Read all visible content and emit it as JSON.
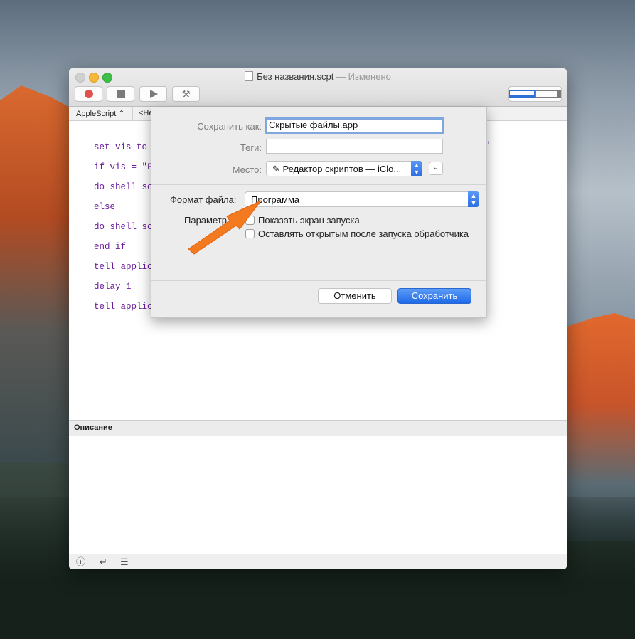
{
  "window": {
    "title": "Без названия.scpt",
    "title_status": "— Изменено"
  },
  "toolbar": {
    "record_label": "Record",
    "stop_label": "Stop",
    "run_label": "Run",
    "compile_label": "Compile"
  },
  "navbar": {
    "language": "AppleScript",
    "element": "<He"
  },
  "editor": {
    "lines": [
      "set vis to",
      "if vis = \"F",
      "do shell sc",
      "else",
      "do shell sc",
      "end if",
      "tell applic",
      "delay 1",
      "tell applic"
    ],
    "line1_tail": "\""
  },
  "description_panel": {
    "header": "Описание"
  },
  "save_sheet": {
    "save_as_label": "Сохранить как:",
    "save_as_value": "Скрытые файлы.app",
    "tags_label": "Теги:",
    "tags_value": "",
    "location_label": "Место:",
    "location_value": "Редактор скриптов — iClo...",
    "file_format_label": "Формат файла:",
    "file_format_value": "Программа",
    "options_label": "Параметр",
    "option1": "Показать экран запуска",
    "option2": "Оставлять открытым после запуска обработчика",
    "cancel_label": "Отменить",
    "save_label": "Сохранить"
  },
  "colors": {
    "accent": "#2c6ee0",
    "arrow": "#f47a1f",
    "code": "#6a1b9a"
  }
}
